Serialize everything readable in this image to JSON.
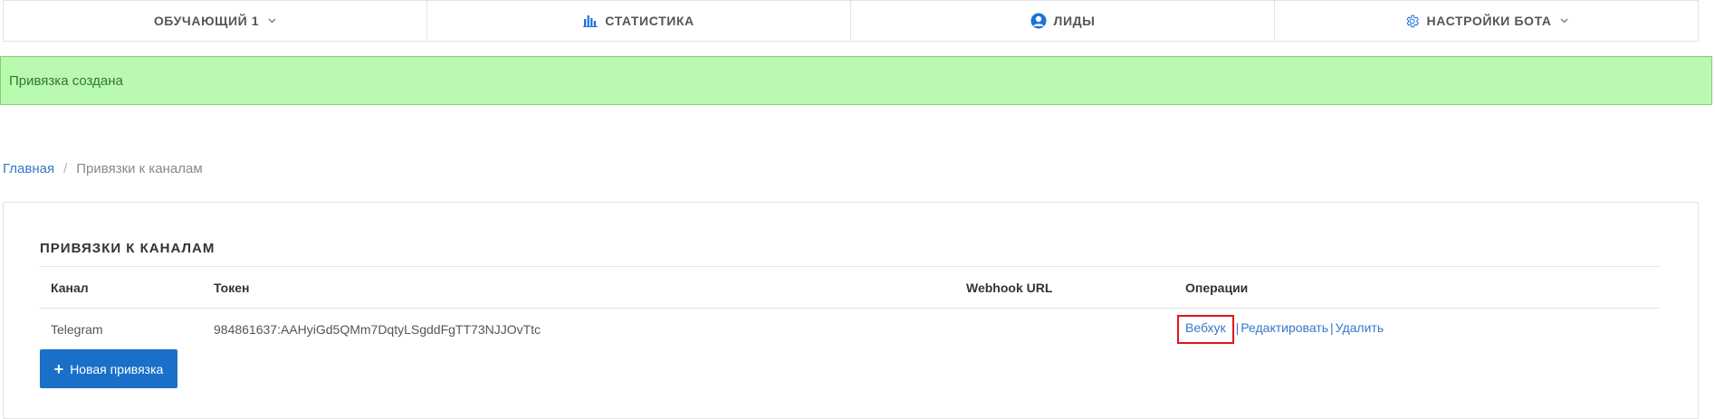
{
  "topnav": {
    "items": [
      {
        "label": "ОБУЧАЮЩИЙ 1",
        "icon": "chevron-down-icon"
      },
      {
        "label": "СТАТИСТИКА",
        "icon": "bar-chart-icon"
      },
      {
        "label": "ЛИДЫ",
        "icon": "user-icon"
      },
      {
        "label": "НАСТРОЙКИ БОТА",
        "icon": "gear-icon"
      }
    ]
  },
  "alert": {
    "text": "Привязка создана"
  },
  "breadcrumb": {
    "home": "Главная",
    "separator": "/",
    "current": "Привязки к каналам"
  },
  "panel": {
    "title": "ПРИВЯЗКИ К КАНАЛАМ",
    "columns": [
      "Канал",
      "Токен",
      "Webhook URL",
      "Операции"
    ],
    "rows": [
      {
        "channel": "Telegram",
        "token": "984861637:AAHyiGd5QMm7DqtyLSgddFgTT73NJJOvTtc",
        "webhook_url": "",
        "ops": {
          "webhook": "Вебхук",
          "edit": "Редактировать",
          "delete": "Удалить",
          "sep": "|"
        }
      }
    ],
    "new_button": "Новая привязка"
  },
  "colors": {
    "accent": "#1a6fc9",
    "link": "#3578c9",
    "alert_bg": "#baf9b0",
    "highlight": "#e0151c"
  }
}
